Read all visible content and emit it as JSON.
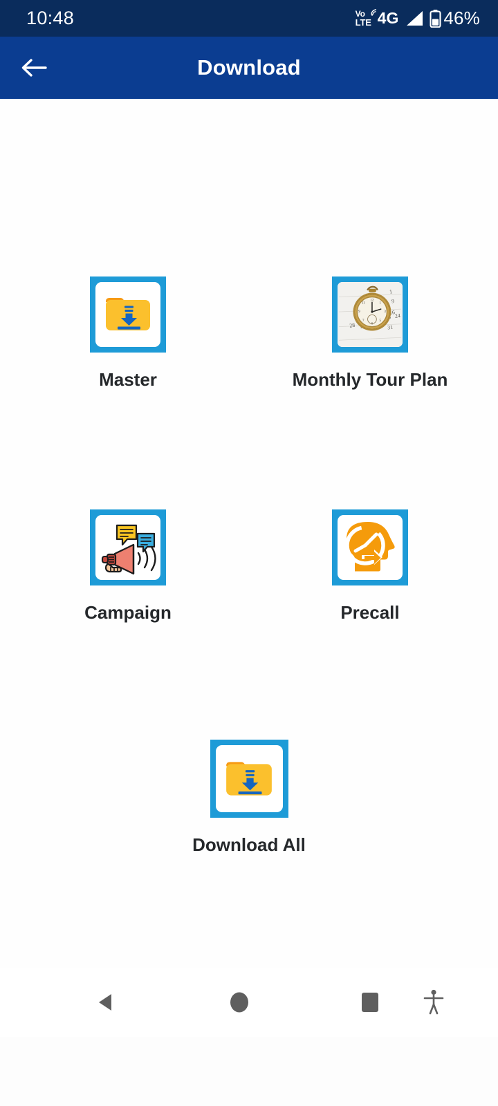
{
  "status_bar": {
    "time": "10:48",
    "volte_top": "Vo",
    "volte_bottom": "LTE",
    "network": "4G",
    "battery_percent": "46%",
    "icons": [
      "volte-icon",
      "signal-bars-icon",
      "battery-icon"
    ],
    "background_color": "#0a2c5c"
  },
  "app_bar": {
    "title": "Download",
    "back_label": "Back",
    "background_color": "#0b3d91",
    "text_color": "#ffffff"
  },
  "theme": {
    "tile_border_color": "#1E9BD7",
    "folder_yellow": "#FBC02D",
    "folder_tab_orange": "#F79B14",
    "arrow_blue": "#1565C0",
    "precall_orange": "#F59B0B",
    "megaphone_red": "#E8705F",
    "label_color": "#25282b",
    "page_background": "#ffffff"
  },
  "main": {
    "rows": [
      {
        "items": [
          {
            "id": "master",
            "label": "Master",
            "icon": "folder-download-icon"
          },
          {
            "id": "monthly-tour-plan",
            "label": "Monthly Tour Plan",
            "icon": "pocket-watch-calendar-icon"
          }
        ]
      },
      {
        "items": [
          {
            "id": "campaign",
            "label": "Campaign",
            "icon": "megaphone-icon"
          },
          {
            "id": "precall",
            "label": "Precall",
            "icon": "head-clock-icon"
          }
        ]
      },
      {
        "items": [
          {
            "id": "download-all",
            "label": "Download All",
            "icon": "folder-download-icon"
          }
        ]
      }
    ]
  },
  "nav_bar": {
    "back": "back-triangle-icon",
    "home": "home-circle-icon",
    "recents": "recents-square-icon",
    "accessibility": "accessibility-person-icon",
    "icon_color": "#5f5f5f"
  }
}
